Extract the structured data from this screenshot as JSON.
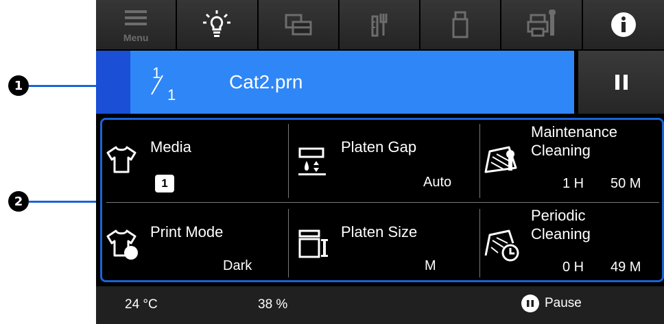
{
  "callouts": {
    "one": "1",
    "two": "2"
  },
  "toolbar": {
    "menu_label": "Menu",
    "buttons": [
      {
        "icon": "menu-icon"
      },
      {
        "icon": "light-bulb-icon"
      },
      {
        "icon": "print-queue-icon"
      },
      {
        "icon": "maintenance-tools-icon"
      },
      {
        "icon": "usb-drive-icon"
      },
      {
        "icon": "printer-settings-icon"
      },
      {
        "icon": "info-icon"
      }
    ]
  },
  "job": {
    "current": "1",
    "total": "1",
    "filename": "Cat2.prn"
  },
  "status_panel": {
    "media": {
      "title": "Media",
      "value": "1"
    },
    "platen_gap": {
      "title": "Platen Gap",
      "value": "Auto"
    },
    "maintenance_cleaning": {
      "title_line1": "Maintenance",
      "title_line2": "Cleaning",
      "hours": "1 H",
      "minutes": "50 M"
    },
    "print_mode": {
      "title": "Print Mode",
      "value": "Dark"
    },
    "platen_size": {
      "title": "Platen Size",
      "value": "M"
    },
    "periodic_cleaning": {
      "title_line1": "Periodic",
      "title_line2": "Cleaning",
      "hours": "0 H",
      "minutes": "49 M"
    }
  },
  "statusbar": {
    "temperature": "24 °C",
    "humidity": "38 %",
    "pause_label": "Pause"
  },
  "colors": {
    "accent_blue": "#2f86f6",
    "outline_blue": "#1a63d8",
    "job_edge": "#1a4fd6"
  }
}
